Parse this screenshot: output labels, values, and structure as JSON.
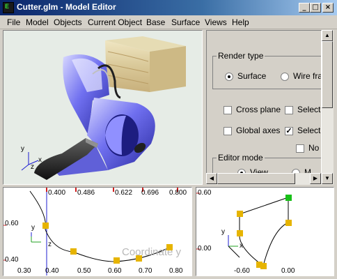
{
  "window": {
    "title": "Cutter.glm - Model Editor",
    "icon_text": "E",
    "min": "_",
    "max": "□",
    "close": "×"
  },
  "menu": [
    "File",
    "Model",
    "Objects",
    "Current Object",
    "Base",
    "Surface",
    "Views",
    "Help"
  ],
  "panel": {
    "render_type_label": "Render type",
    "radio_surface": "Surface",
    "radio_wire": "Wire fram",
    "cross_plane": "Cross plane",
    "selected1": "Selecte",
    "global_axes": "Global axes",
    "selected2": "Selecte",
    "no": "No",
    "editor_mode_label": "Editor mode",
    "radio_view": "View",
    "radio_mod": "M",
    "check_mark": "✓"
  },
  "scrollbar": {
    "up": "▲",
    "down": "▼",
    "left": "◀",
    "right": "▶"
  },
  "axes": {
    "y": "y",
    "x": "x",
    "z": "z"
  },
  "left_view": {
    "top_ticks": [
      "0.400",
      "0.486",
      "0.622",
      "0.696",
      "0.800"
    ],
    "bottom_ticks": [
      "0.30",
      "0.40",
      "0.50",
      "0.60",
      "0.70",
      "0.80"
    ],
    "y_ticks": [
      "0.60",
      "0.40"
    ],
    "watermark": "Coordinate y"
  },
  "right_view": {
    "y_ticks": [
      "0.60",
      "0.00"
    ],
    "bottom_ticks": [
      "-0.60",
      "0.00"
    ]
  },
  "colors": {
    "control_point": "#e6b400",
    "selected_point": "#18c018",
    "model_blue": "#6a6ae8",
    "axis_blue": "#1c1cd2"
  }
}
